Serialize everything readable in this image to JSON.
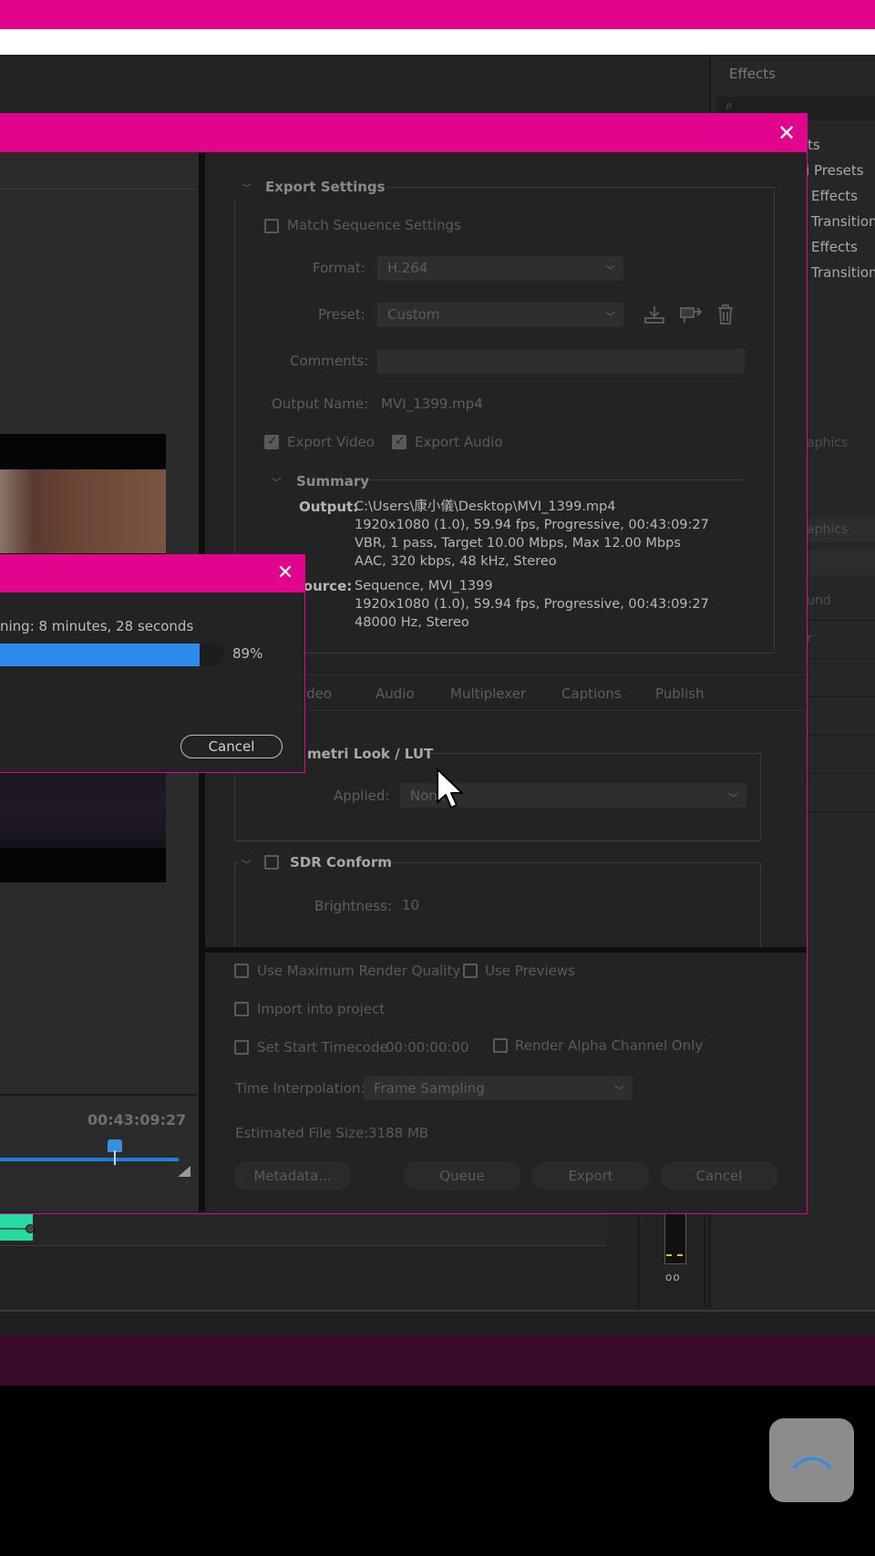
{
  "effects_panel": {
    "title": "Effects",
    "items": [
      "ts",
      "tri Presets",
      "Effects",
      "Transition",
      "Effects",
      "Transition"
    ],
    "ghost_items": [
      "aphics",
      "aphics",
      "und",
      "r"
    ]
  },
  "meter": {
    "label": "oo"
  },
  "export_dialog": {
    "export_settings": {
      "title": "Export Settings",
      "match_sequence_label": "Match Sequence Settings",
      "format_label": "Format:",
      "format_value": "H.264",
      "preset_label": "Preset:",
      "preset_value": "Custom",
      "comments_label": "Comments:",
      "output_name_label": "Output Name:",
      "output_name_value": "MVI_1399.mp4",
      "export_video_label": "Export Video",
      "export_audio_label": "Export Audio"
    },
    "summary": {
      "title": "Summary",
      "output_key": "Output:",
      "output_lines": [
        "C:\\Users\\康小儀\\Desktop\\MVI_1399.mp4",
        "1920x1080 (1.0), 59.94 fps, Progressive, 00:43:09:27",
        "VBR, 1 pass, Target 10.00 Mbps, Max 12.00 Mbps",
        "AAC, 320 kbps, 48 kHz, Stereo"
      ],
      "source_key": "Source:",
      "source_lines": [
        "Sequence, MVI_1399",
        "1920x1080 (1.0), 59.94 fps, Progressive, 00:43:09:27",
        "48000 Hz, Stereo"
      ]
    },
    "tabs": [
      "Video",
      "Audio",
      "Multiplexer",
      "Captions",
      "Publish"
    ],
    "lumetri": {
      "title": "metri Look / LUT",
      "applied_label": "Applied:",
      "applied_value": "None"
    },
    "sdr": {
      "title": "SDR Conform",
      "brightness_label": "Brightness:",
      "brightness_value": "10"
    },
    "options": {
      "max_render_label": "Use Maximum Render Quality",
      "use_previews_label": "Use Previews",
      "import_label": "Import into project",
      "start_tc_label": "Set Start Timecode",
      "start_tc_value": "00:00:00:00",
      "alpha_label": "Render Alpha Channel Only",
      "interp_label": "Time Interpolation:",
      "interp_value": "Frame Sampling",
      "file_size_label": "Estimated File Size:",
      "file_size_value": "3188 MB"
    },
    "buttons": {
      "metadata": "Metadata...",
      "queue": "Queue",
      "export": "Export",
      "cancel": "Cancel"
    },
    "source_timecode": "00:43:09:27"
  },
  "progress_dialog": {
    "remaining_text": "ning: 8 minutes, 28 seconds",
    "progress_percent": 89,
    "progress_label": "89%",
    "cancel_label": "Cancel"
  },
  "colors": {
    "accent": "#e0058c",
    "progress": "#2d8ceb",
    "clip": "#27d9a3"
  }
}
